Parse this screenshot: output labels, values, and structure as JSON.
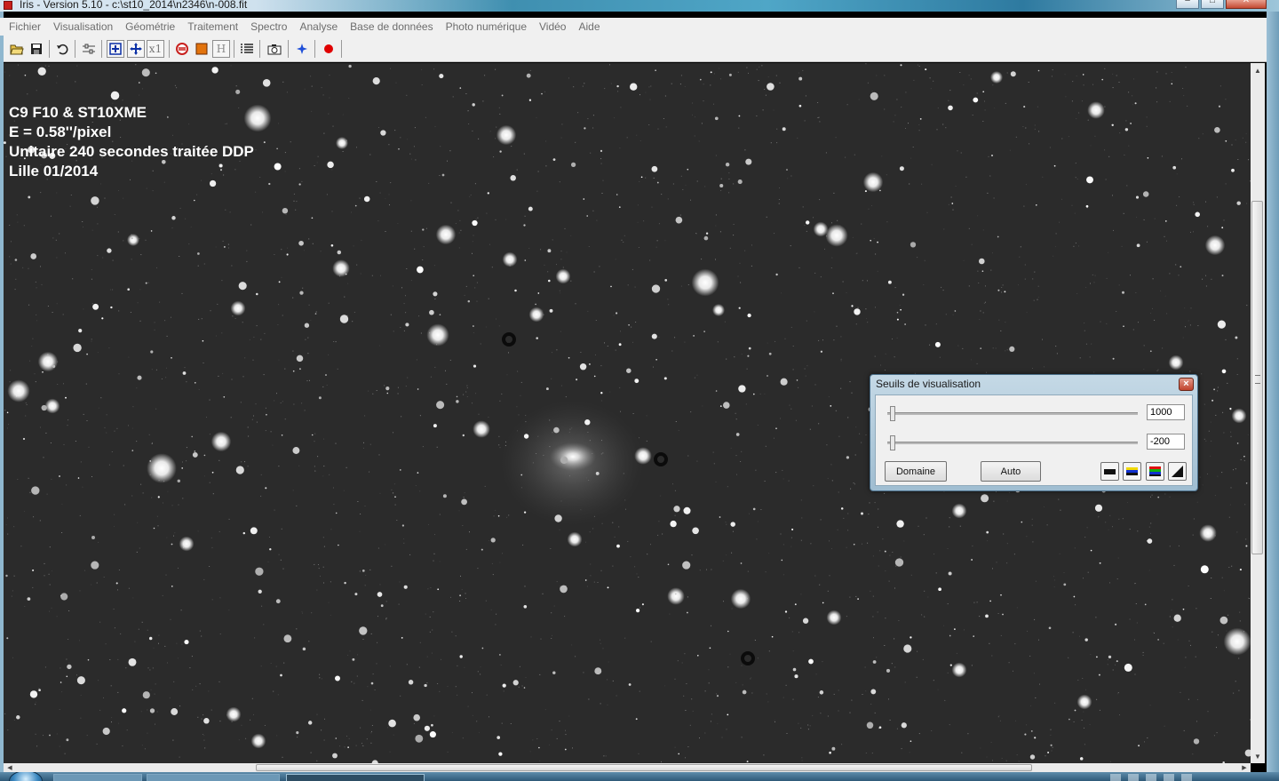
{
  "window": {
    "title": "Iris - Version 5.10 - c:\\st10_2014\\n2346\\n-008.fit",
    "caption_buttons": [
      "minimize-icon",
      "maximize-icon",
      "close-icon"
    ]
  },
  "menu": {
    "items": [
      "Fichier",
      "Visualisation",
      "Géométrie",
      "Traitement",
      "Spectro",
      "Analyse",
      "Base de données",
      "Photo numérique",
      "Vidéo",
      "Aide"
    ]
  },
  "toolbar": {
    "x1_label": "x1",
    "h_label": "H",
    "icons": [
      "open-folder-icon",
      "save-disk-icon",
      "undo-icon",
      "adjust-icon",
      "zoom-in-icon",
      "move-icon",
      "zoom-x1-icon",
      "convert-icon",
      "color-tool-icon",
      "histogram-icon",
      "list-icon",
      "camera-icon",
      "compass-icon",
      "record-icon"
    ]
  },
  "image": {
    "caption_lines": [
      "C9 F10 & ST10XME",
      "E = 0.58''/pixel",
      "Unitaire 240 secondes traitée DDP",
      "Lille 01/2014"
    ]
  },
  "dialog": {
    "title": "Seuils de visualisation",
    "high_threshold": "1000",
    "low_threshold": "-200",
    "domain_button": "Domaine",
    "auto_button": "Auto",
    "palette_buttons": [
      "grayscale-palette-icon",
      "yellow-blue-palette-icon",
      "rainbow-palette-icon",
      "gradient-palette-icon"
    ]
  },
  "colors": {
    "menu_text": "#6d6d6d",
    "sky_background": "#2b2b2b",
    "record": "#e00000",
    "dialog_frame": "#9fbdd1"
  }
}
